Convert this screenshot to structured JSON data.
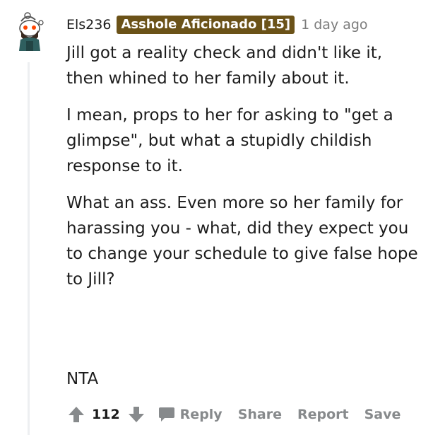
{
  "comment": {
    "username": "Els236",
    "flair": "Asshole Aficionado [15]",
    "timestamp": "1 day ago",
    "paragraphs": [
      "Jill got a reality check and didn't like it, then whined to her family about it.",
      "I mean, props to her for asking to \"get a glimpse\", but what a stupidly childish response to it.",
      "What an ass. Even more so her family for harassing you - what, did they expect you to change your schedule to give false hope to Jill?"
    ],
    "verdict": "NTA"
  },
  "actions": {
    "vote_count": "112",
    "reply_label": "Reply",
    "share_label": "Share",
    "report_label": "Report",
    "save_label": "Save"
  },
  "colors": {
    "flair_bg": "#6b5218",
    "muted_text": "#878a8c",
    "thread_line": "#edeff1"
  },
  "icons": {
    "avatar": "snoo-avatar-icon",
    "upvote": "arrow-up-icon",
    "downvote": "arrow-down-icon",
    "reply": "speech-bubble-icon"
  }
}
